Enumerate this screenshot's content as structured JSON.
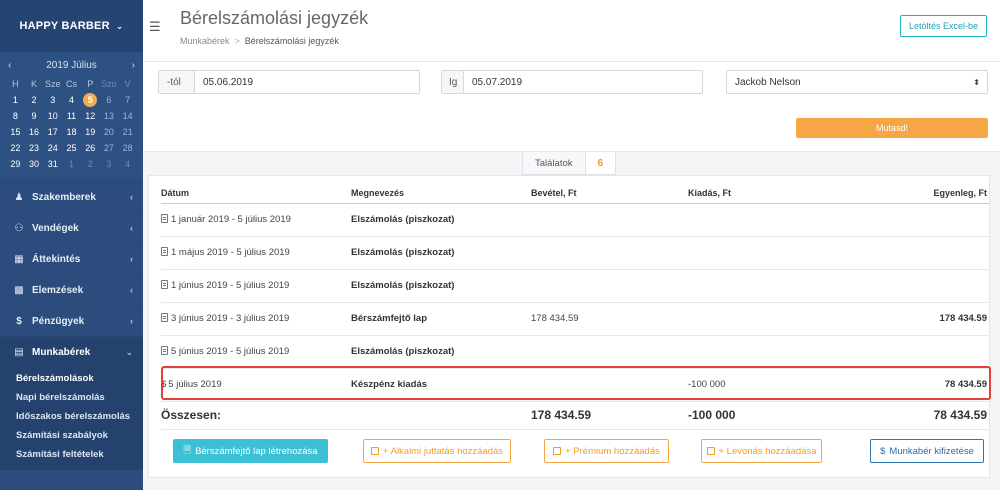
{
  "brand": {
    "name": "HAPPY BARBER"
  },
  "calendar": {
    "month_label": "2019 Július",
    "weekdays": [
      "H",
      "K",
      "Sze",
      "Cs",
      "P",
      "Szo",
      "V"
    ],
    "weeks": [
      [
        "1",
        "2",
        "3",
        "4",
        "5",
        "6",
        "7"
      ],
      [
        "8",
        "9",
        "10",
        "11",
        "12",
        "13",
        "14"
      ],
      [
        "15",
        "16",
        "17",
        "18",
        "19",
        "20",
        "21"
      ],
      [
        "22",
        "23",
        "24",
        "25",
        "26",
        "27",
        "28"
      ],
      [
        "29",
        "30",
        "31",
        "1",
        "2",
        "3",
        "4"
      ]
    ],
    "today": "5"
  },
  "menu": {
    "items": [
      {
        "label": "Szakemberek",
        "icon": "user-icon"
      },
      {
        "label": "Vendégek",
        "icon": "users-icon"
      },
      {
        "label": "Áttekintés",
        "icon": "grid-icon"
      },
      {
        "label": "Elemzések",
        "icon": "bar-chart-icon"
      },
      {
        "label": "Pénzügyek",
        "icon": "dollar-icon"
      },
      {
        "label": "Munkabérek",
        "icon": "id-card-icon"
      }
    ],
    "submenu": [
      "Bérelszámolások",
      "Napi bérelszámolás",
      "Időszakos bérelszámolás",
      "Számítási szabályok",
      "Számítási feltételek"
    ]
  },
  "header": {
    "title": "Bérelszámolási jegyzék",
    "breadcrumb_parent": "Munkabérek",
    "breadcrumb_sep": ">",
    "breadcrumb_current": "Bérelszámolási jegyzék",
    "excel_button": "Letöltés Excel-be"
  },
  "filters": {
    "from_label": "-tól",
    "from_value": "05.06.2019",
    "to_label": "Ig",
    "to_value": "05.07.2019",
    "employee": "Jackob Nelson",
    "show_button": "Mutasd!"
  },
  "results": {
    "label": "Találatok",
    "count": "6"
  },
  "table": {
    "headers": {
      "date": "Dátum",
      "name": "Megnevezés",
      "income": "Bevétel, Ft",
      "expense": "Kiadás, Ft",
      "balance": "Egyenleg, Ft"
    },
    "rows": [
      {
        "icon": "document-icon",
        "date": "1 január 2019 - 5 július 2019",
        "name": "Elszámolás (piszkozat)",
        "income": "",
        "expense": "",
        "balance": ""
      },
      {
        "icon": "document-icon",
        "date": "1 május 2019 - 5 július 2019",
        "name": "Elszámolás (piszkozat)",
        "income": "",
        "expense": "",
        "balance": ""
      },
      {
        "icon": "document-icon",
        "date": "1 június 2019 - 5 július 2019",
        "name": "Elszámolás (piszkozat)",
        "income": "",
        "expense": "",
        "balance": ""
      },
      {
        "icon": "document-icon",
        "date": "3 június 2019 - 3 július 2019",
        "name": "Bérszámfejtő lap",
        "income": "178 434.59",
        "expense": "",
        "balance": "178 434.59"
      },
      {
        "icon": "document-icon",
        "date": "5 június 2019 - 5 július 2019",
        "name": "Elszámolás (piszkozat)",
        "income": "",
        "expense": "",
        "balance": ""
      },
      {
        "icon": "dollar-icon",
        "date": "5 július 2019",
        "name": "Készpénz kiadás",
        "income": "",
        "expense": "-100 000",
        "balance": "78 434.59"
      }
    ],
    "total": {
      "label": "Összesen:",
      "income": "178 434.59",
      "expense": "-100 000",
      "balance": "78 434.59"
    }
  },
  "actions": {
    "create_sheet": "Bérszámfejtő lap létrehozása",
    "add_bonus": "+ Alkalmi juttatás hozzáadás",
    "add_premium": "+ Prémium hozzáadás",
    "add_deduction": "+ Levonás hozzáadása",
    "pay_salary": "Munkabér kifizetése"
  },
  "colors": {
    "sidebar": "#2b4c7c",
    "accent_orange": "#f6a645",
    "accent_cyan": "#3cc0d4",
    "highlight_red": "#e2403a"
  }
}
